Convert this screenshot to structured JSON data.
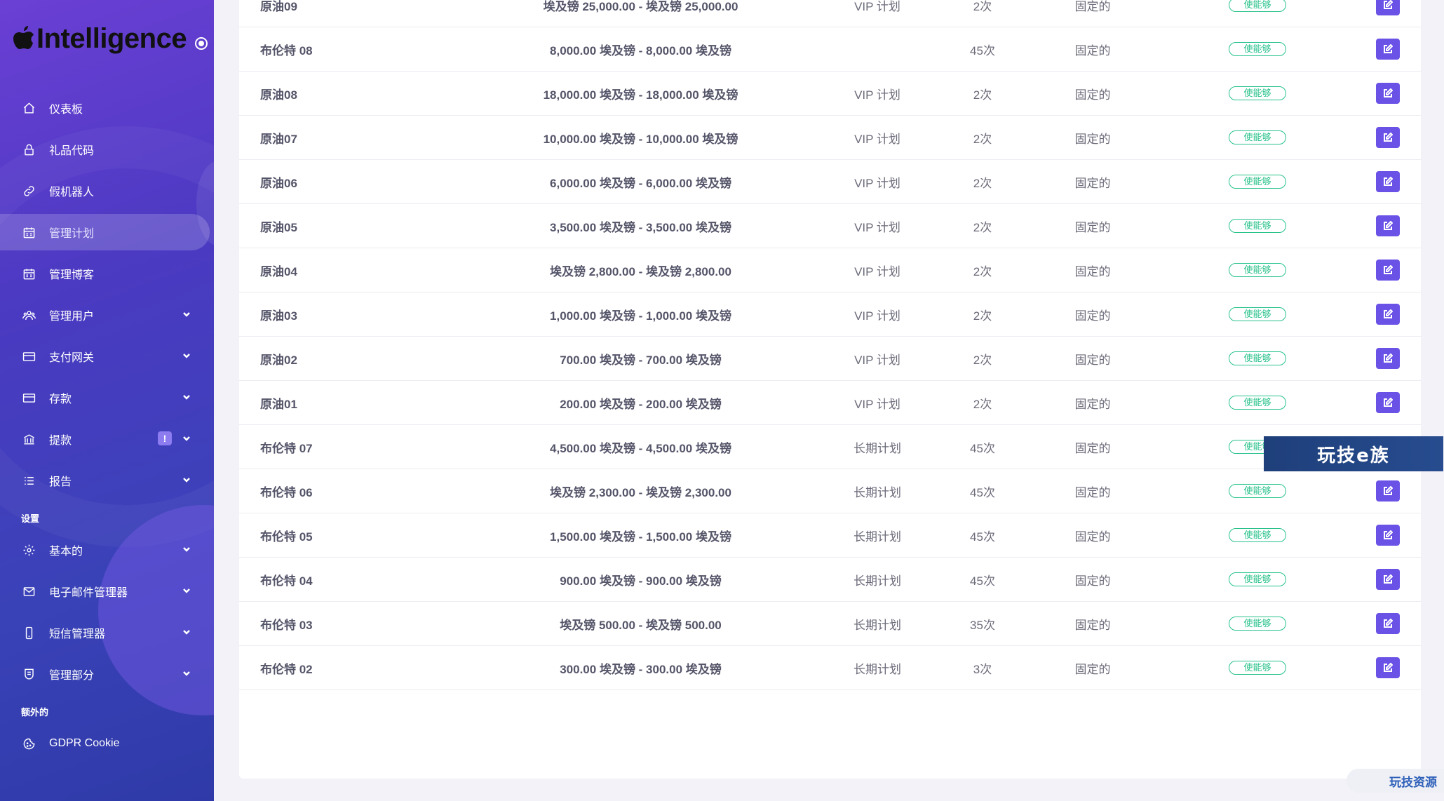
{
  "brand": {
    "name": "Intelligence"
  },
  "sidebar": {
    "items": [
      {
        "label": "仪表板",
        "icon": "home-icon",
        "active": false,
        "chevron": false
      },
      {
        "label": "礼品代码",
        "icon": "lock-icon",
        "active": false,
        "chevron": false
      },
      {
        "label": "假机器人",
        "icon": "link-icon",
        "active": false,
        "chevron": false
      },
      {
        "label": "管理计划",
        "icon": "calendar-icon",
        "active": true,
        "chevron": false
      },
      {
        "label": "管理博客",
        "icon": "calendar-icon",
        "active": false,
        "chevron": false
      },
      {
        "label": "管理用户",
        "icon": "users-icon",
        "active": false,
        "chevron": true
      },
      {
        "label": "支付网关",
        "icon": "card-icon",
        "active": false,
        "chevron": true
      },
      {
        "label": "存款",
        "icon": "card-icon",
        "active": false,
        "chevron": true
      },
      {
        "label": "提款",
        "icon": "bank-icon",
        "active": false,
        "chevron": true,
        "badge": "!"
      },
      {
        "label": "报告",
        "icon": "list-icon",
        "active": false,
        "chevron": true
      }
    ],
    "section_settings": "设置",
    "settings_items": [
      {
        "label": "基本的",
        "icon": "gear-icon",
        "chevron": true
      },
      {
        "label": "电子邮件管理器",
        "icon": "mail-icon",
        "chevron": true
      },
      {
        "label": "短信管理器",
        "icon": "phone-icon",
        "chevron": true
      },
      {
        "label": "管理部分",
        "icon": "shield-icon",
        "chevron": true
      }
    ],
    "section_extra": "额外的",
    "extra_items": [
      {
        "label": "GDPR Cookie",
        "icon": "cookie-icon",
        "chevron": false
      }
    ]
  },
  "plans": {
    "rows": [
      {
        "name": "原油09",
        "amount": "埃及镑 25,000.00 - 埃及镑 25,000.00",
        "plan": "VIP 计划",
        "times": "2次",
        "type": "固定的",
        "status": "使能够"
      },
      {
        "name": "布伦特 08",
        "amount": "8,000.00 埃及镑 - 8,000.00 埃及镑",
        "plan": "",
        "times": "45次",
        "type": "固定的",
        "status": "使能够"
      },
      {
        "name": "原油08",
        "amount": "18,000.00 埃及镑 - 18,000.00 埃及镑",
        "plan": "VIP 计划",
        "times": "2次",
        "type": "固定的",
        "status": "使能够"
      },
      {
        "name": "原油07",
        "amount": "10,000.00 埃及镑 - 10,000.00 埃及镑",
        "plan": "VIP 计划",
        "times": "2次",
        "type": "固定的",
        "status": "使能够"
      },
      {
        "name": "原油06",
        "amount": "6,000.00 埃及镑 - 6,000.00 埃及镑",
        "plan": "VIP 计划",
        "times": "2次",
        "type": "固定的",
        "status": "使能够"
      },
      {
        "name": "原油05",
        "amount": "3,500.00 埃及镑 - 3,500.00 埃及镑",
        "plan": "VIP 计划",
        "times": "2次",
        "type": "固定的",
        "status": "使能够"
      },
      {
        "name": "原油04",
        "amount": "埃及镑 2,800.00 - 埃及镑 2,800.00",
        "plan": "VIP 计划",
        "times": "2次",
        "type": "固定的",
        "status": "使能够"
      },
      {
        "name": "原油03",
        "amount": "1,000.00 埃及镑 - 1,000.00 埃及镑",
        "plan": "VIP 计划",
        "times": "2次",
        "type": "固定的",
        "status": "使能够"
      },
      {
        "name": "原油02",
        "amount": "700.00 埃及镑 - 700.00 埃及镑",
        "plan": "VIP 计划",
        "times": "2次",
        "type": "固定的",
        "status": "使能够"
      },
      {
        "name": "原油01",
        "amount": "200.00 埃及镑 - 200.00 埃及镑",
        "plan": "VIP 计划",
        "times": "2次",
        "type": "固定的",
        "status": "使能够"
      },
      {
        "name": "布伦特 07",
        "amount": "4,500.00 埃及镑 - 4,500.00 埃及镑",
        "plan": "长期计划",
        "times": "45次",
        "type": "固定的",
        "status": "使能够"
      },
      {
        "name": "布伦特 06",
        "amount": "埃及镑 2,300.00 - 埃及镑 2,300.00",
        "plan": "长期计划",
        "times": "45次",
        "type": "固定的",
        "status": "使能够"
      },
      {
        "name": "布伦特 05",
        "amount": "1,500.00 埃及镑 - 1,500.00 埃及镑",
        "plan": "长期计划",
        "times": "45次",
        "type": "固定的",
        "status": "使能够"
      },
      {
        "name": "布伦特 04",
        "amount": "900.00 埃及镑 - 900.00 埃及镑",
        "plan": "长期计划",
        "times": "45次",
        "type": "固定的",
        "status": "使能够"
      },
      {
        "name": "布伦特 03",
        "amount": "埃及镑 500.00 - 埃及镑 500.00",
        "plan": "长期计划",
        "times": "35次",
        "type": "固定的",
        "status": "使能够"
      },
      {
        "name": "布伦特 02",
        "amount": "300.00 埃及镑 - 300.00 埃及镑",
        "plan": "长期计划",
        "times": "3次",
        "type": "固定的",
        "status": "使能够"
      }
    ]
  },
  "watermarks": {
    "banner": "玩技e族",
    "corner": "玩技资源"
  },
  "colors": {
    "accent": "#6a52e6",
    "status_green": "#27c28a",
    "sidebar_start": "#6b3fd4",
    "sidebar_end": "#2f3aa8"
  }
}
